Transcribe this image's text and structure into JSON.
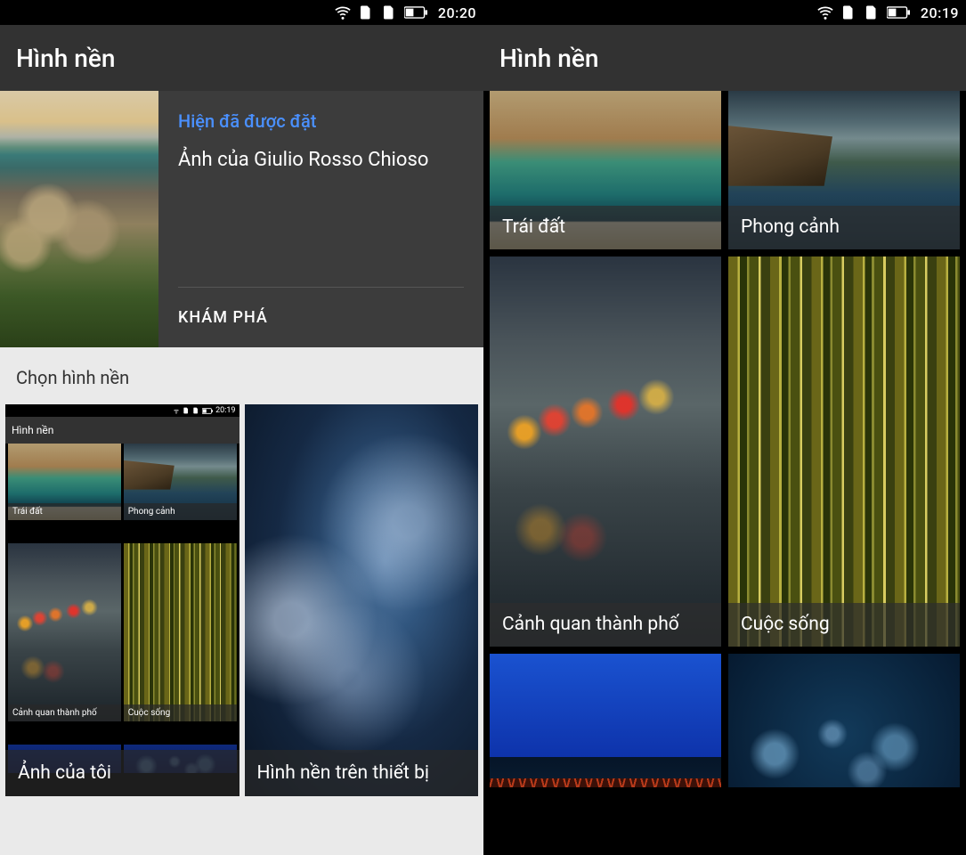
{
  "left": {
    "statusbar": {
      "time": "20:20"
    },
    "header": {
      "title": "Hình nền"
    },
    "hero": {
      "status_label": "Hiện đã được đặt",
      "author_label": "Ảnh của Giulio Rosso Chioso",
      "action_label": "KHÁM PHÁ"
    },
    "section_title": "Chọn hình nền",
    "tiles": {
      "my_photos_label": "Ảnh của tôi",
      "device_wallpapers_label": "Hình nền trên thiết bị"
    },
    "mini": {
      "time": "20:19",
      "title": "Hình nền",
      "cat1": "Trái đất",
      "cat2": "Phong cảnh",
      "cat3": "Cảnh quan thành phố",
      "cat4": "Cuộc sống"
    }
  },
  "right": {
    "statusbar": {
      "time": "20:19"
    },
    "header": {
      "title": "Hình nền"
    },
    "categories": [
      {
        "label": "Trái đất"
      },
      {
        "label": "Phong cảnh"
      },
      {
        "label": "Cảnh quan thành phố"
      },
      {
        "label": "Cuộc sống"
      }
    ]
  }
}
